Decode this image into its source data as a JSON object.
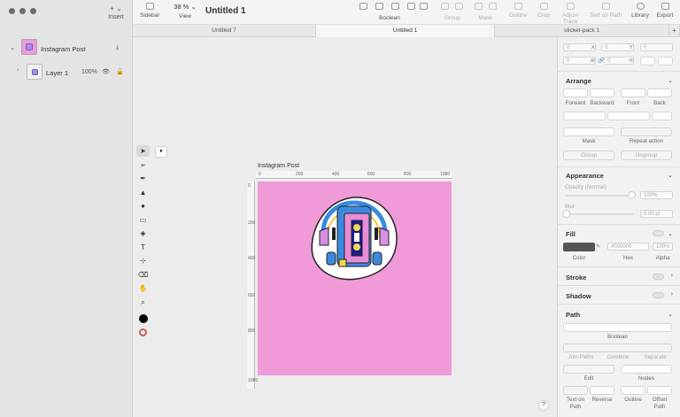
{
  "window": {
    "title": "Untitled 1"
  },
  "toolbar": {
    "sidebar_label": "Sidebar",
    "zoom": "38 %",
    "view_label": "View",
    "insert_label": "Insert",
    "boolean_label": "Boolean",
    "group_label": "Group",
    "mask_label": "Mask",
    "outline_label": "Outline",
    "crop_label": "Crop",
    "adjust_trace_label": "Adjust Trace",
    "text_on_path_label": "Text on Path",
    "library_label": "Library",
    "export_label": "Export"
  },
  "tabs": [
    "Untitled 7",
    "Untitled 1",
    "sticker-pack 1"
  ],
  "layers": [
    {
      "name": "Instagram Post",
      "expanded": true
    },
    {
      "name": "Layer 1",
      "opacity": "100%"
    }
  ],
  "canvas": {
    "artboard_label": "Instagram Post",
    "background": "#f09ad8",
    "ruler_x": [
      "0",
      "200",
      "400",
      "600",
      "800",
      "1080"
    ],
    "ruler_y": [
      "0",
      "200",
      "400",
      "600",
      "800",
      "1080"
    ]
  },
  "inspector": {
    "geometry": {
      "x": "0",
      "y": "0",
      "rot": "0",
      "w": "0",
      "h": "0",
      "x_label": "X",
      "y_label": "Y",
      "w_label": "W",
      "h_label": "H"
    },
    "arrange": {
      "title": "Arrange",
      "forward": "Forward",
      "backward": "Backward",
      "front": "Front",
      "back": "Back",
      "mask": "Mask",
      "repeat": "Repeat action",
      "group": "Group",
      "ungroup": "Ungroup"
    },
    "appearance": {
      "title": "Appearance",
      "opacity_label": "Opacity (Normal)",
      "opacity_value": "100%",
      "blur_label": "Blur",
      "blur_value": "0.00 pt"
    },
    "fill": {
      "title": "Fill",
      "hex": "#000000",
      "alpha": "100%",
      "color_label": "Color",
      "hex_label": "Hex",
      "alpha_label": "Alpha",
      "swatch": "#555555"
    },
    "stroke": {
      "title": "Stroke"
    },
    "shadow": {
      "title": "Shadow"
    },
    "path": {
      "title": "Path",
      "boolean": "Boolean",
      "join_paths": "Join Paths",
      "combine": "Combine",
      "separate": "Separate",
      "edit": "Edit",
      "nodes": "Nodes",
      "text_on_path": "Text on Path",
      "reverse": "Reverse",
      "outline": "Outline",
      "offset_path": "Offset Path"
    }
  },
  "help": "?"
}
